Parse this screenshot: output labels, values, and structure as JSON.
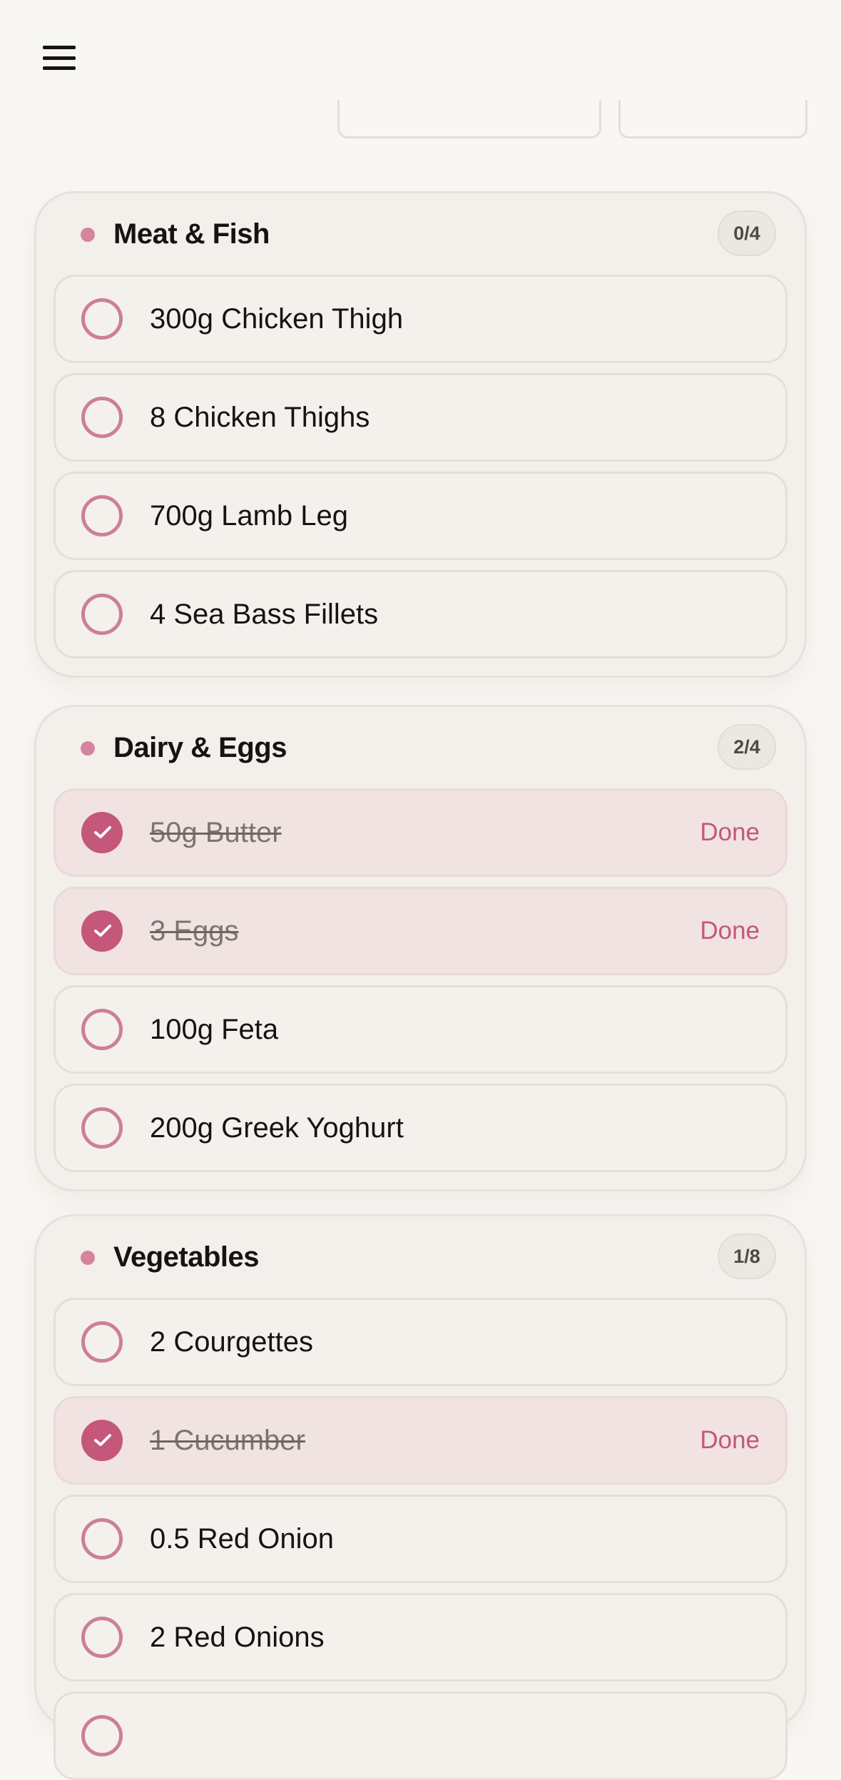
{
  "header": {
    "menu_icon": "hamburger-menu-icon"
  },
  "categories": [
    {
      "name": "Meat & Fish",
      "count": "0/4",
      "items": [
        {
          "label": "300g Chicken Thigh",
          "done": false
        },
        {
          "label": "8 Chicken Thighs",
          "done": false
        },
        {
          "label": "700g Lamb Leg",
          "done": false
        },
        {
          "label": "4 Sea Bass Fillets",
          "done": false
        }
      ]
    },
    {
      "name": "Dairy & Eggs",
      "count": "2/4",
      "items": [
        {
          "label": "50g Butter",
          "done": true,
          "status": "Done"
        },
        {
          "label": "3 Eggs",
          "done": true,
          "status": "Done"
        },
        {
          "label": "100g Feta",
          "done": false
        },
        {
          "label": "200g Greek Yoghurt",
          "done": false
        }
      ]
    },
    {
      "name": "Vegetables",
      "count": "1/8",
      "items": [
        {
          "label": "2 Courgettes",
          "done": false
        },
        {
          "label": "1 Cucumber",
          "done": true,
          "status": "Done"
        },
        {
          "label": "0.5 Red Onion",
          "done": false
        },
        {
          "label": "2 Red Onions",
          "done": false
        }
      ]
    }
  ],
  "colors": {
    "accent": "#c4577a",
    "accent_light": "#cd7f97",
    "background": "#f9f7f3",
    "card": "#f3f0ec",
    "done_row": "#f0e3e2"
  }
}
